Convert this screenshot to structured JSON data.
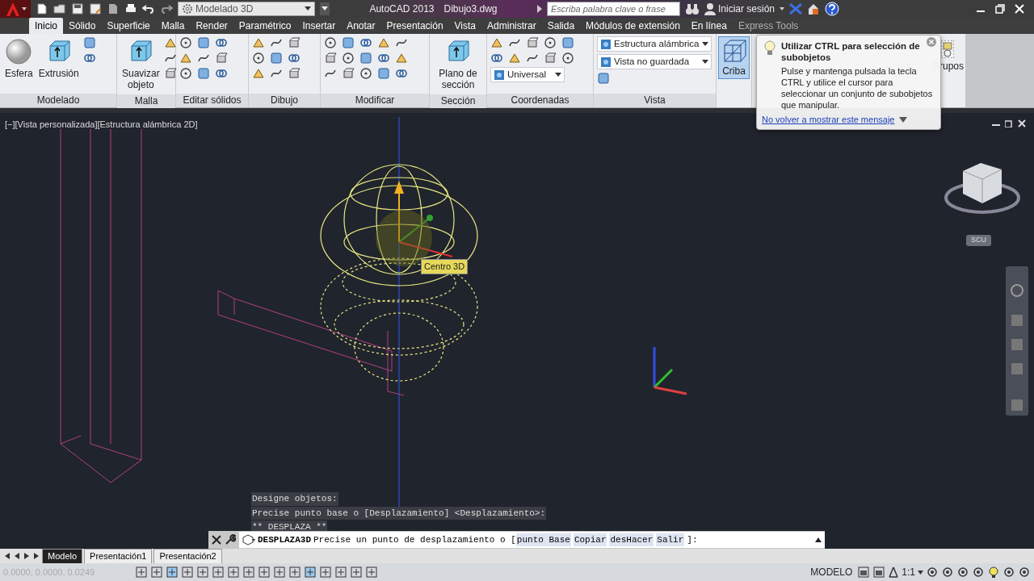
{
  "title_bar": {
    "workspace": "Modelado 3D",
    "app_name": "AutoCAD 2013",
    "file_name": "Dibujo3.dwg",
    "search": {
      "placeholder": "Escriba palabra clave o frase"
    },
    "sign_in": "Iniciar sesión"
  },
  "tabs": [
    {
      "label": "Inicio",
      "selected": true
    },
    {
      "label": "Sólido",
      "selected": false
    },
    {
      "label": "Superficie",
      "selected": false
    },
    {
      "label": "Malla",
      "selected": false
    },
    {
      "label": "Render",
      "selected": false
    },
    {
      "label": "Paramétrico",
      "selected": false
    },
    {
      "label": "Insertar",
      "selected": false
    },
    {
      "label": "Anotar",
      "selected": false
    },
    {
      "label": "Presentación",
      "selected": false
    },
    {
      "label": "Vista",
      "selected": false
    },
    {
      "label": "Administrar",
      "selected": false
    },
    {
      "label": "Salida",
      "selected": false
    },
    {
      "label": "Módulos de extensión",
      "selected": false
    },
    {
      "label": "En línea",
      "selected": false
    },
    {
      "label": "Express Tools",
      "selected": false
    }
  ],
  "ribbon": {
    "panels": [
      {
        "title": "Modelado",
        "controls": [
          {
            "kind": "large",
            "label": "Esfera"
          },
          {
            "kind": "large",
            "label": "Extrusión"
          }
        ]
      },
      {
        "title": "Malla",
        "controls": [
          {
            "kind": "large",
            "label": "Suavizar objeto"
          }
        ]
      },
      {
        "title": "Editar sólidos"
      },
      {
        "title": "Dibujo"
      },
      {
        "title": "Modificar"
      },
      {
        "title": "Sección",
        "controls": [
          {
            "kind": "large",
            "label": "Plano de sección"
          }
        ]
      },
      {
        "title": "Coordenadas",
        "controls": [
          {
            "kind": "dropdown",
            "label": "Universal"
          }
        ]
      },
      {
        "title": "Vista",
        "controls": [
          {
            "kind": "dropdown",
            "label": "Estructura alámbrica"
          },
          {
            "kind": "dropdown",
            "label": "Vista no guardada"
          }
        ]
      }
    ],
    "selection": {
      "label": "Criba",
      "selected": true
    },
    "groups": {
      "label": "Grupos"
    }
  },
  "tooltip": {
    "title": "Utilizar CTRL para selección de subobjetos",
    "body": "Pulse y mantenga pulsada la tecla CTRL y utilice el cursor para seleccionar un conjunto de subobjetos que manipular.",
    "link": "No volver a mostrar este mensaje"
  },
  "viewport": {
    "label": "[−][Vista personalizada][Estructura alámbrica 2D]",
    "gizmo_label": "Centro 3D",
    "ucs_button": "SCU"
  },
  "command_history": [
    "Designe objetos:",
    "Precise punto base o [Desplazamiento] <Desplazamiento>:",
    "** DESPLAZA **"
  ],
  "command_line": {
    "command": "DESPLAZA3D",
    "prompt": "Precise un punto de desplazamiento o [",
    "options": [
      "punto Base",
      "Copiar",
      "desHacer",
      "Salir"
    ],
    "end": "]:"
  },
  "layout_tabs": [
    {
      "label": "Modelo",
      "selected": true
    },
    {
      "label": "Presentación1",
      "selected": false
    },
    {
      "label": "Presentación2",
      "selected": false
    }
  ],
  "status_bar": {
    "coordinates": "0.0000, 0.0000, 0.0249",
    "space": "MODELO",
    "scale": "1:1"
  }
}
